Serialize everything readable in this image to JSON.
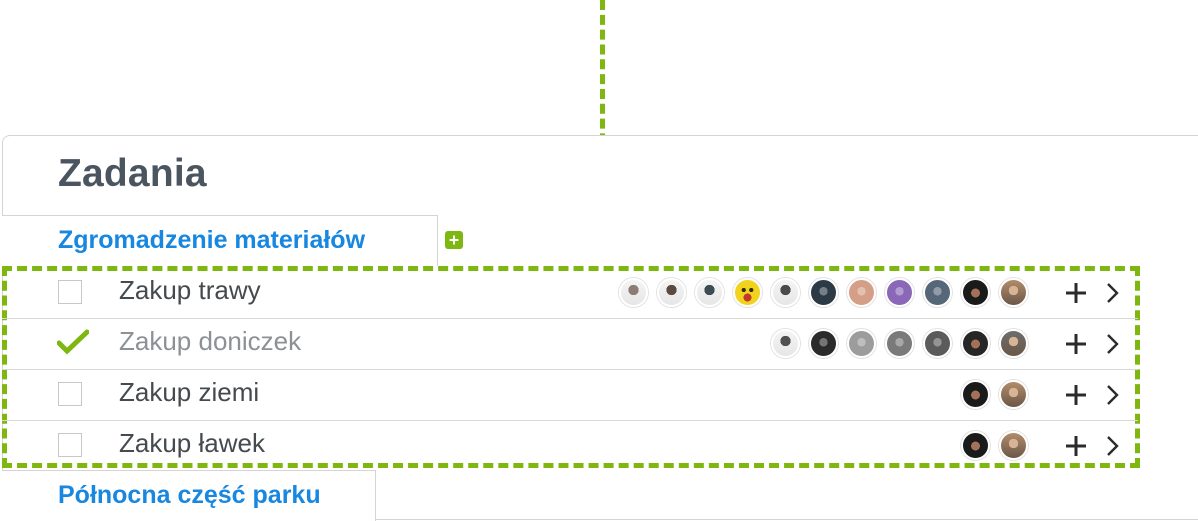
{
  "page": {
    "title": "Zadania"
  },
  "groups": [
    {
      "label": "Zgromadzenie materiałów"
    },
    {
      "label": "Północna część parku"
    }
  ],
  "icons": {
    "add_group": "plus-square-icon",
    "add_member": "plus-icon",
    "open": "chevron-right-icon",
    "check": "checkmark-icon"
  },
  "colors": {
    "accent_green": "#7db70f",
    "link_blue": "#1787e0",
    "heading": "#4a5560",
    "text": "#454a4e",
    "done_text": "#8c9196"
  },
  "tasks": [
    {
      "label": "Zakup trawy",
      "checked": false,
      "avatars": [
        {
          "name": "member-avatar",
          "tone": "#8b7d74",
          "style": "photo-light-bg"
        },
        {
          "name": "member-avatar",
          "tone": "#5a4a3f",
          "style": "photo-light-bg"
        },
        {
          "name": "member-avatar",
          "tone": "#3d4b52",
          "style": "photo-light-bg"
        },
        {
          "name": "member-avatar",
          "tone": "#f1d31e",
          "style": "emoji-face"
        },
        {
          "name": "member-avatar",
          "tone": "#4a4a4a",
          "style": "photo-light-bg"
        },
        {
          "name": "member-avatar",
          "tone": "#2b3a45",
          "style": "photo-dark"
        },
        {
          "name": "member-avatar",
          "tone": "#d59f87",
          "style": "photo-light"
        },
        {
          "name": "member-avatar",
          "tone": "#8a67b7",
          "style": "photo-purple"
        },
        {
          "name": "member-avatar",
          "tone": "#56677a",
          "style": "photo-dark"
        },
        {
          "name": "member-avatar",
          "tone": "#1a1a1a",
          "style": "photo-dark-hair"
        },
        {
          "name": "member-avatar",
          "tone": "#b28c6a",
          "style": "photo-beard"
        }
      ]
    },
    {
      "label": "Zakup doniczek",
      "checked": true,
      "avatars": [
        {
          "name": "member-avatar",
          "tone": "#505050",
          "style": "photo-light-bg"
        },
        {
          "name": "member-avatar",
          "tone": "#2a2a2a",
          "style": "photo-dark"
        },
        {
          "name": "member-avatar",
          "tone": "#9c9c9c",
          "style": "photo-light"
        },
        {
          "name": "member-avatar",
          "tone": "#7a7a7a",
          "style": "photo-light"
        },
        {
          "name": "member-avatar",
          "tone": "#5b5b5b",
          "style": "photo-dark"
        },
        {
          "name": "member-avatar",
          "tone": "#262626",
          "style": "photo-dark-hair"
        },
        {
          "name": "member-avatar",
          "tone": "#6d6d6d",
          "style": "photo-beard"
        }
      ]
    },
    {
      "label": "Zakup ziemi",
      "checked": false,
      "avatars": [
        {
          "name": "member-avatar",
          "tone": "#1a1a1a",
          "style": "photo-dark-hair"
        },
        {
          "name": "member-avatar",
          "tone": "#b28c6a",
          "style": "photo-beard"
        }
      ]
    },
    {
      "label": "Zakup ławek",
      "checked": false,
      "avatars": [
        {
          "name": "member-avatar",
          "tone": "#1a1a1a",
          "style": "photo-dark-hair"
        },
        {
          "name": "member-avatar",
          "tone": "#b28c6a",
          "style": "photo-beard"
        }
      ]
    }
  ]
}
